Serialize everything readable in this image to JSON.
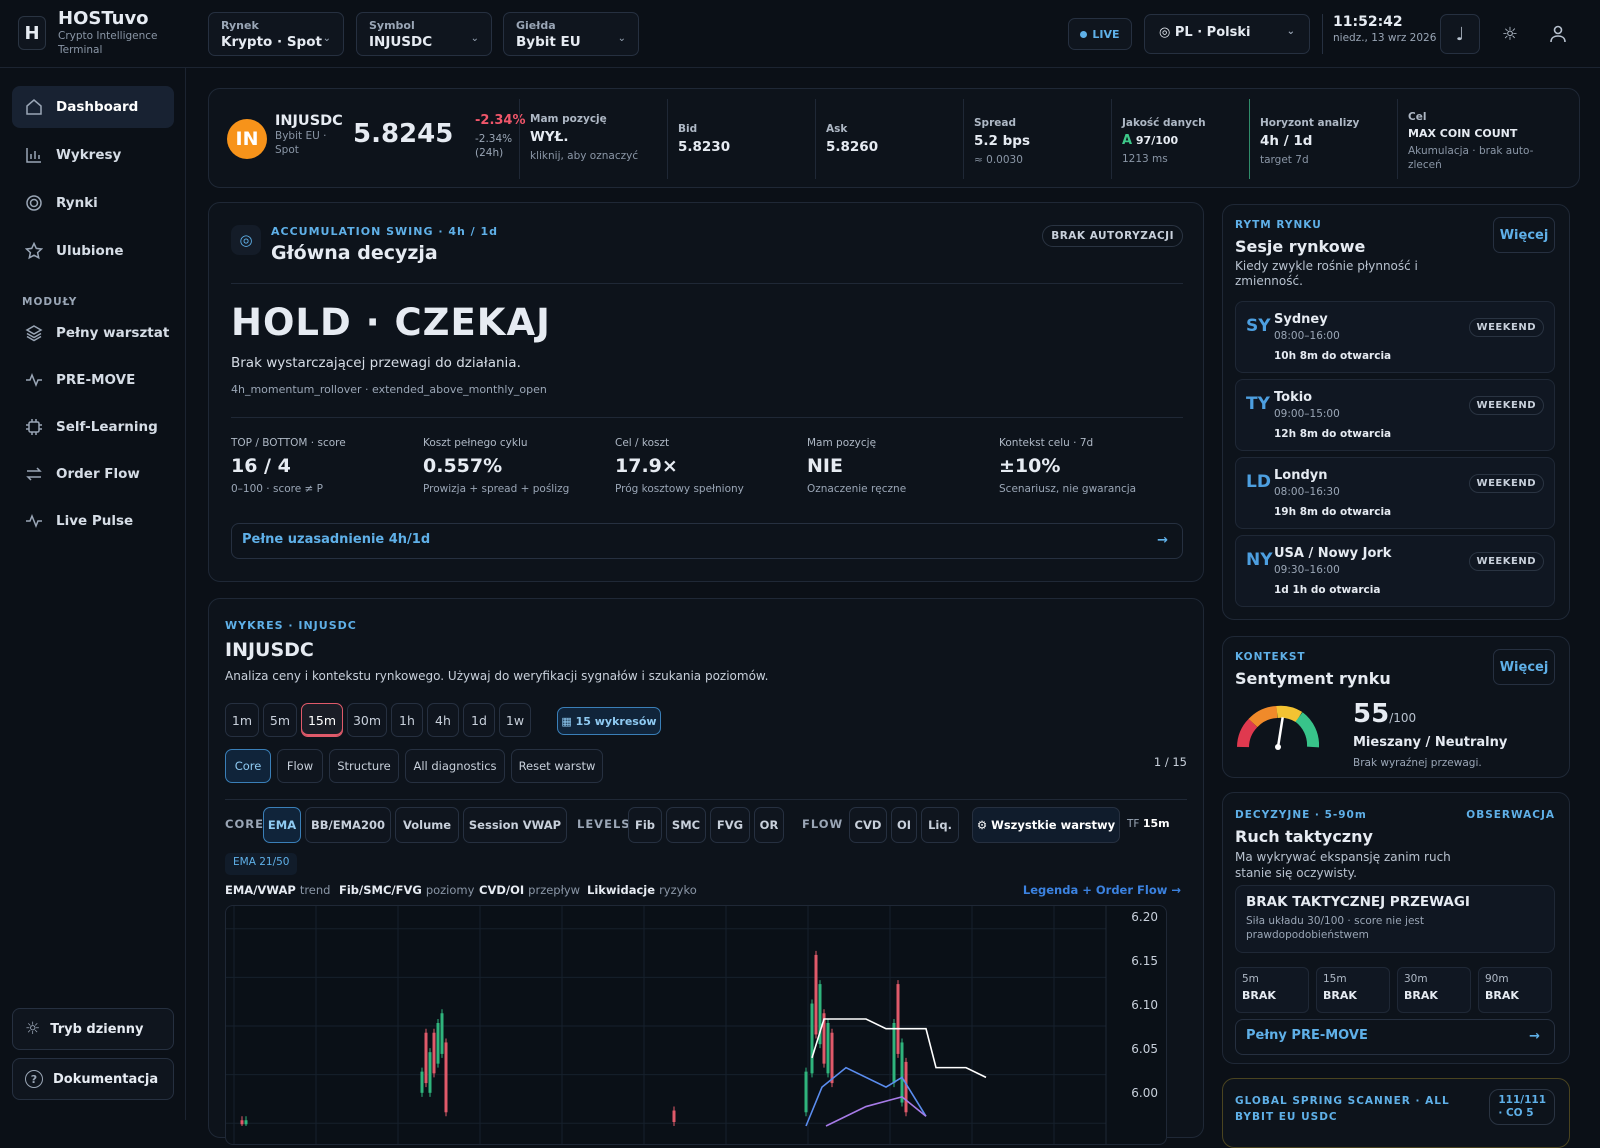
{
  "header": {
    "logo": "H",
    "brand": "HOSTuvo",
    "brand_sub1": "Crypto Intelligence",
    "brand_sub2": "Terminal",
    "selects": [
      {
        "label": "Rynek",
        "value": "Krypto · Spot"
      },
      {
        "label": "Symbol",
        "value": "INJUSDC"
      },
      {
        "label": "Giełda",
        "value": "Bybit EU"
      }
    ],
    "live": "LIVE",
    "lang": "PL · Polski",
    "time": "11:52:42",
    "date": "niedz., 13 wrz 2026"
  },
  "sidebar": {
    "items": [
      {
        "label": "Dashboard",
        "icon": "home-icon"
      },
      {
        "label": "Wykresy",
        "icon": "bar-chart-icon"
      },
      {
        "label": "Rynki",
        "icon": "target-icon"
      },
      {
        "label": "Ulubione",
        "icon": "star-icon"
      }
    ],
    "modules_heading": "MODUŁY",
    "modules": [
      {
        "label": "Pełny warsztat",
        "icon": "layers-icon"
      },
      {
        "label": "PRE-MOVE",
        "icon": "pulse-icon"
      },
      {
        "label": "Self-Learning",
        "icon": "chip-icon"
      },
      {
        "label": "Order Flow",
        "icon": "arrows-icon"
      },
      {
        "label": "Live Pulse",
        "icon": "pulse-icon"
      }
    ],
    "day_mode": "Tryb dzienny",
    "docs": "Dokumentacja"
  },
  "ticker": {
    "coin": "IN",
    "symbol": "INJUSDC",
    "exchange": "Bybit EU ·",
    "market": "Spot",
    "price": "5.8245",
    "change": "-2.34%",
    "change2": "-2.34%",
    "change_period": "(24h)",
    "cells": [
      {
        "label": "Mam pozycję",
        "value": "WYŁ.",
        "sub": "kliknij, aby oznaczyć"
      },
      {
        "label": "Bid",
        "value": "5.8230",
        "sub": ""
      },
      {
        "label": "Ask",
        "value": "5.8260",
        "sub": ""
      },
      {
        "label": "Spread",
        "value": "5.2 bps",
        "sub": "≈ 0.0030"
      },
      {
        "label": "Jakość danych",
        "grade": "A",
        "value": "97/100",
        "sub": "1213 ms"
      },
      {
        "label": "Horyzont analizy",
        "value": "4h / 1d",
        "sub": "target 7d"
      },
      {
        "label": "Cel",
        "value": "MAX COIN COUNT",
        "sub": "Akumulacja · brak auto-zleceń"
      }
    ]
  },
  "decision": {
    "kicker": "ACCUMULATION SWING · 4h / 1d",
    "title": "Główna decyzja",
    "badge": "BRAK AUTORYZACJI",
    "verdict": "HOLD · CZEKAJ",
    "reason": "Brak wystarczającej przewagi do działania.",
    "tags": "4h_momentum_rollover · extended_above_monthly_open",
    "metrics": [
      {
        "label": "TOP / BOTTOM · score",
        "value": "16 / 4",
        "sub": "0–100 · score ≠ P"
      },
      {
        "label": "Koszt pełnego cyklu",
        "value": "0.557%",
        "sub": "Prowizja + spread + poślizg"
      },
      {
        "label": "Cel / koszt",
        "value": "17.9×",
        "sub": "Próg kosztowy spełniony"
      },
      {
        "label": "Mam pozycję",
        "value": "NIE",
        "sub": "Oznaczenie ręczne"
      },
      {
        "label": "Kontekst celu · 7d",
        "value": "±10%",
        "sub": "Scenariusz, nie gwarancja"
      }
    ],
    "link": "Pełne uzasadnienie 4h/1d",
    "arrow": "→"
  },
  "chart": {
    "kicker": "WYKRES · INJUSDC",
    "title": "INJUSDC",
    "desc": "Analiza ceny i kontekstu rynkowego. Używaj do weryfikacji sygnałów i szukania poziomów.",
    "timeframes": [
      "1m",
      "5m",
      "15m",
      "30m",
      "1h",
      "4h",
      "1d",
      "1w"
    ],
    "active_tf": "15m",
    "charts_btn": "▦ 15 wykresów",
    "presets": [
      "Core",
      "Flow",
      "Structure",
      "All diagnostics",
      "Reset warstw"
    ],
    "page": "1 / 15",
    "groups": {
      "core": "CORE",
      "levels": "LEVELS",
      "flow": "FLOW"
    },
    "core_layers": [
      "EMA",
      "BB/EMA200",
      "Volume",
      "Session VWAP"
    ],
    "level_layers": [
      "Fib",
      "SMC",
      "FVG",
      "OR"
    ],
    "flow_layers": [
      "CVD",
      "OI",
      "Liq."
    ],
    "all_layers": "⚙ Wszystkie warstwy",
    "tf_label": "TF",
    "tf_value": "15m",
    "ema_pill": "EMA 21/50",
    "legend": [
      {
        "b": "EMA/VWAP",
        "t": "trend"
      },
      {
        "b": "Fib/SMC/FVG",
        "t": "poziomy"
      },
      {
        "b": "CVD/OI",
        "t": "przepływ"
      },
      {
        "b": "Likwidacje",
        "t": "ryzyko"
      }
    ],
    "legend_link": "Legenda + Order Flow →",
    "y_ticks": [
      "6.20",
      "6.15",
      "6.10",
      "6.05",
      "6.00"
    ]
  },
  "chart_data": {
    "type": "candlestick",
    "y_ticks": [
      6.2,
      6.15,
      6.1,
      6.05,
      6.0
    ],
    "ylim": [
      5.99,
      6.21
    ]
  },
  "sessions": {
    "kicker": "RYTM RYNKU",
    "title": "Sesje rynkowe",
    "desc": "Kiedy zwykle rośnie płynność i zmienność.",
    "more": "Więcej",
    "items": [
      {
        "abbr": "SY",
        "name": "Sydney",
        "hours": "08:00–16:00",
        "open": "10h 8m do otwarcia",
        "status": "WEEKEND"
      },
      {
        "abbr": "TY",
        "name": "Tokio",
        "hours": "09:00–15:00",
        "open": "12h 8m do otwarcia",
        "status": "WEEKEND"
      },
      {
        "abbr": "LD",
        "name": "Londyn",
        "hours": "08:00–16:30",
        "open": "19h 8m do otwarcia",
        "status": "WEEKEND"
      },
      {
        "abbr": "NY",
        "name": "USA / Nowy Jork",
        "hours": "09:30–16:00",
        "open": "1d 1h do otwarcia",
        "status": "WEEKEND"
      }
    ]
  },
  "sentiment": {
    "kicker": "KONTEKST",
    "title": "Sentyment rynku",
    "more": "Więcej",
    "value": "55",
    "max": "/100",
    "label": "Mieszany / Neutralny",
    "sub": "Brak wyraźnej przewagi.",
    "level": 0.55
  },
  "tactical": {
    "kicker": "DECYZYJNE · 5-90m",
    "status": "OBSERWACJA",
    "title": "Ruch taktyczny",
    "desc": "Ma wykrywać ekspansję zanim ruch stanie się oczywisty.",
    "box_title": "BRAK TAKTYCZNEJ PRZEWAGI",
    "box_sub": "Siła układu 30/100 · score nie jest prawdopodobieństwem",
    "tfs": [
      {
        "l": "5m",
        "v": "BRAK"
      },
      {
        "l": "15m",
        "v": "BRAK"
      },
      {
        "l": "30m",
        "v": "BRAK"
      },
      {
        "l": "90m",
        "v": "BRAK"
      }
    ],
    "link": "Pełny PRE-MOVE",
    "arrow": "→"
  },
  "scanner": {
    "title": "GLOBAL SPRING SCANNER · ALL",
    "sub": "BYBIT EU USDC",
    "count": "111/111",
    "count2": "· CO 5"
  }
}
